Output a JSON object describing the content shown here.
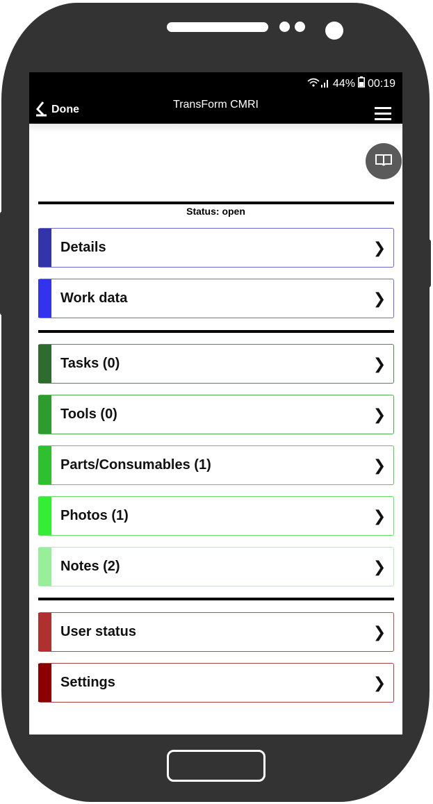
{
  "statusbar": {
    "signal_icon": "wifi-signal-icon",
    "battery_percent": "44%",
    "battery_icon": "battery-icon",
    "time": "00:19"
  },
  "appbar": {
    "back_icon": "back-arrow-icon",
    "back_label": "Done",
    "title": "TransForm CMRI",
    "menu_icon": "hamburger-menu-icon"
  },
  "book_button": {
    "icon": "book-icon"
  },
  "status_line": "Status: open",
  "sections": [
    {
      "rows": [
        {
          "label": "Details",
          "color": "#3333aa",
          "border": "#6a6ac8"
        },
        {
          "label": "Work data",
          "color": "#3333ee",
          "border": "#6a6ae0"
        }
      ]
    },
    {
      "rows": [
        {
          "label": "Tasks (0)",
          "color": "#2e6b2e",
          "border": "#4b8a4b"
        },
        {
          "label": "Tools (0)",
          "color": "#2e9b2e",
          "border": "#4bb04b"
        },
        {
          "label": "Parts/Consumables (1)",
          "color": "#2ec02e",
          "border": "#55c855"
        },
        {
          "label": "Photos (1)",
          "color": "#33ee33",
          "border": "#66e066"
        },
        {
          "label": "Notes (2)",
          "color": "#99ee99",
          "border": "#b5eeb5"
        }
      ]
    },
    {
      "rows": [
        {
          "label": "User status",
          "color": "#b03030",
          "border": "#b05050"
        },
        {
          "label": "Settings",
          "color": "#8b0000",
          "border": "#a04040"
        }
      ]
    }
  ]
}
